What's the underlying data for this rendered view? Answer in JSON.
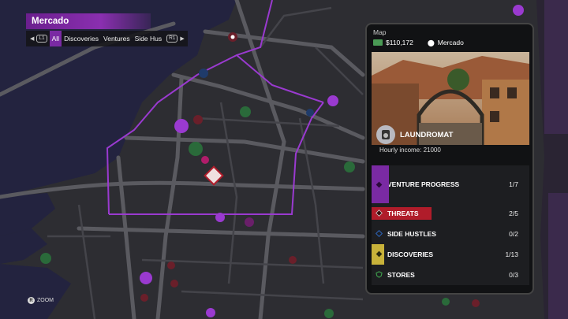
{
  "map": {
    "region_title": "Mercado",
    "filters": [
      "All",
      "Discoveries",
      "Ventures",
      "Side Hus"
    ],
    "active_filter": "All",
    "left_button": "L1",
    "right_button": "R1",
    "zoom_hint": {
      "button": "R",
      "label": "ZOOM"
    },
    "accent_color": "#8a2fb0"
  },
  "panel": {
    "title": "Map",
    "cash": "$110,172",
    "location": "Mercado",
    "venture_name": "LAUNDROMAT",
    "hourly_income": "Hourly income: 21000",
    "rows": [
      {
        "label": "VENTURE PROGRESS",
        "count": "1/7",
        "icon": "diamond-icon",
        "color": "#7a2aa3"
      },
      {
        "label": "THREATS",
        "count": "2/5",
        "icon": "diamond-icon",
        "color": "#b01c2a"
      },
      {
        "label": "SIDE HUSTLES",
        "count": "0/2",
        "icon": "diamond-icon",
        "color": "#2b5fb0"
      },
      {
        "label": "DISCOVERIES",
        "count": "1/13",
        "icon": "diamond-icon",
        "color": "#c8b23a"
      },
      {
        "label": "STORES",
        "count": "0/3",
        "icon": "shield-icon",
        "color": "#3fa34d"
      }
    ]
  }
}
